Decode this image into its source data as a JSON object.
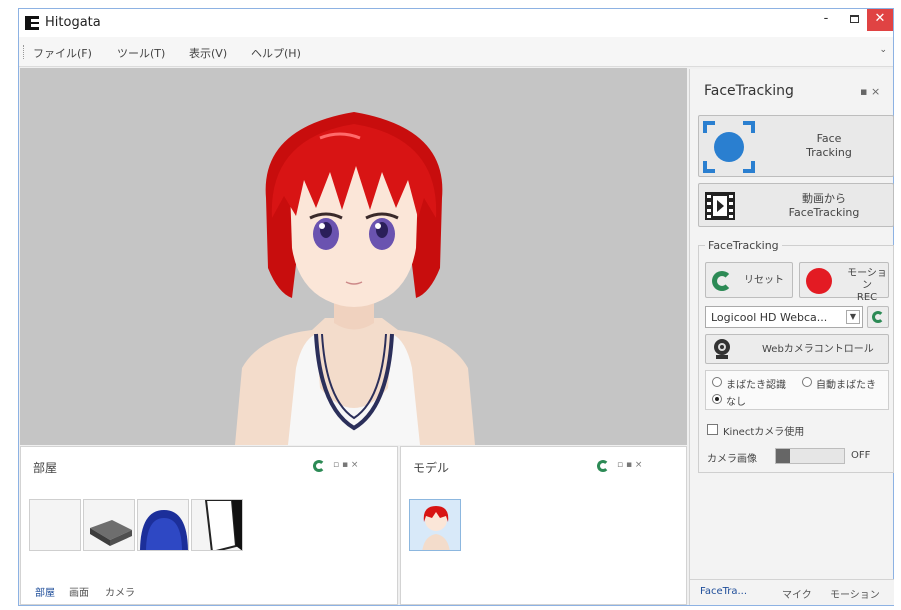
{
  "window": {
    "title": "Hitogata",
    "minimize": "-",
    "close": "✕"
  },
  "menu": [
    "ファイル(F)",
    "ツール(T)",
    "表示(V)",
    "ヘルプ(H)"
  ],
  "room_panel": {
    "title": "部屋",
    "tools": "▫ ▪ ×",
    "tabs": [
      "部屋",
      "画面",
      "カメラ"
    ],
    "active_tab": 0
  },
  "model_panel": {
    "title": "モデル",
    "tools": "▫ ▪ ×"
  },
  "facetracking_panel": {
    "title": "FaceTracking",
    "tools": "▪ ×",
    "face_tracking_button": {
      "line1": "Face",
      "line2": "Tracking"
    },
    "video_button": {
      "line1": "動画から",
      "line2": "FaceTracking"
    },
    "group_label": "FaceTracking",
    "reset_button": "リセット",
    "motion_rec_button": {
      "line1": "モーション",
      "line2": "REC"
    },
    "camera_select": "Logicool HD Webca...",
    "webcam_control_button": "Webカメラコントロール",
    "blink_options": [
      {
        "label": "まばたき認識",
        "selected": false
      },
      {
        "label": "自動まばたき",
        "selected": false
      },
      {
        "label": "なし",
        "selected": true
      }
    ],
    "kinect_checkbox": {
      "label": "Kinectカメラ使用",
      "checked": false
    },
    "camera_image": {
      "label": "カメラ画像",
      "state": "OFF",
      "level": 0.2
    },
    "tabs": [
      "FaceTra...",
      "マイク",
      "モーション"
    ],
    "active_tab": 0
  },
  "colors": {
    "accent": "#1f4e9a",
    "refresh": "#2c8a55",
    "rec": "#e31b23",
    "tracking": "#2a7fd0",
    "close": "#e04343"
  }
}
